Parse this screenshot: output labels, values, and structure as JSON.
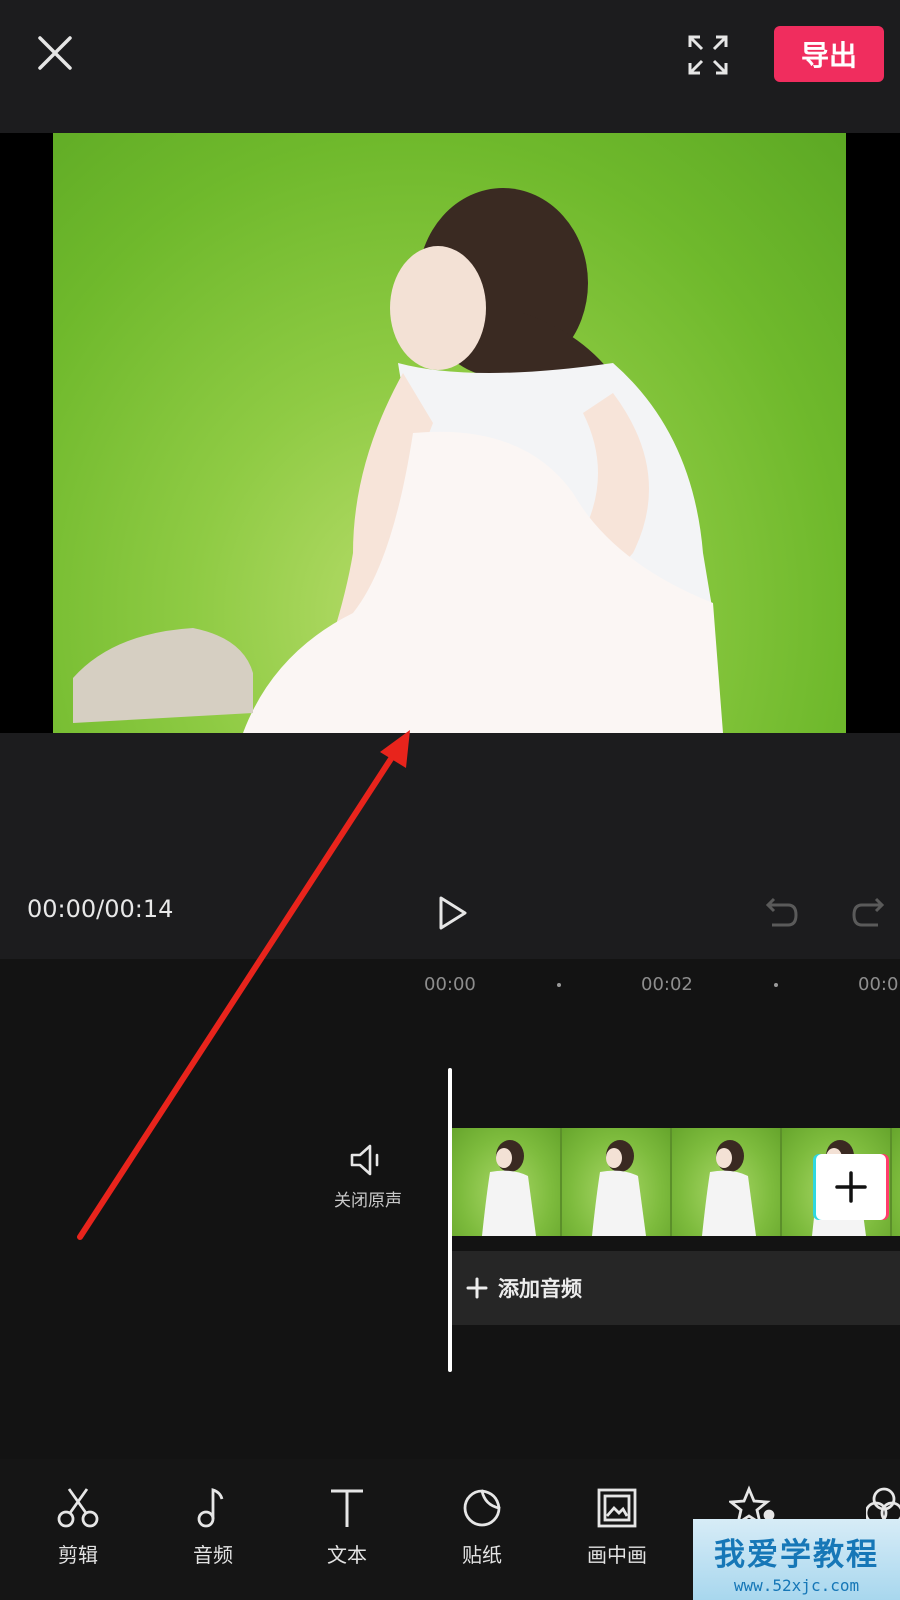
{
  "header": {
    "export_label": "导出"
  },
  "playback": {
    "timecode": "00:00/00:14"
  },
  "timeline": {
    "ruler": [
      "00:00",
      "00:02",
      "00:0"
    ],
    "mute_label": "关闭原声",
    "add_audio_label": "添加音频",
    "thumbnail_count": 5
  },
  "toolbar": {
    "items": [
      {
        "label": "剪辑",
        "icon": "scissors-icon"
      },
      {
        "label": "音频",
        "icon": "music-note-icon"
      },
      {
        "label": "文本",
        "icon": "text-icon"
      },
      {
        "label": "贴纸",
        "icon": "sticker-icon"
      },
      {
        "label": "画中画",
        "icon": "picture-in-picture-icon"
      },
      {
        "label": "",
        "icon": "effects-star-icon"
      },
      {
        "label": "",
        "icon": "filter-icon"
      }
    ]
  },
  "watermark": {
    "title": "我爱学教程",
    "url": "www.52xjc.com"
  },
  "colors": {
    "accent": "#f02d5e",
    "background": "#151515",
    "annotation": "#e8241c"
  }
}
